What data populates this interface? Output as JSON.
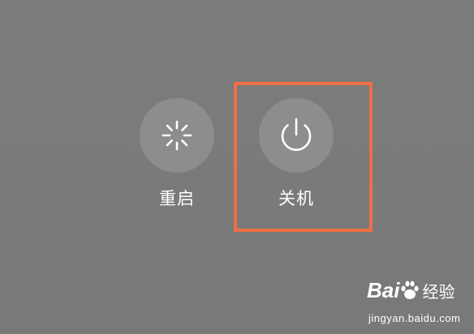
{
  "power_menu": {
    "restart": {
      "label": "重启",
      "icon": "restart-spinner-icon"
    },
    "shutdown": {
      "label": "关机",
      "icon": "power-icon"
    }
  },
  "highlight": {
    "target": "shutdown",
    "color": "#ef6f44"
  },
  "watermark": {
    "brand_prefix": "Bai",
    "brand_suffix": "经验",
    "url": "jingyan.baidu.com"
  },
  "colors": {
    "background": "#7a7b7b",
    "button_circle": "#8c8d8d",
    "text": "#ffffff"
  }
}
